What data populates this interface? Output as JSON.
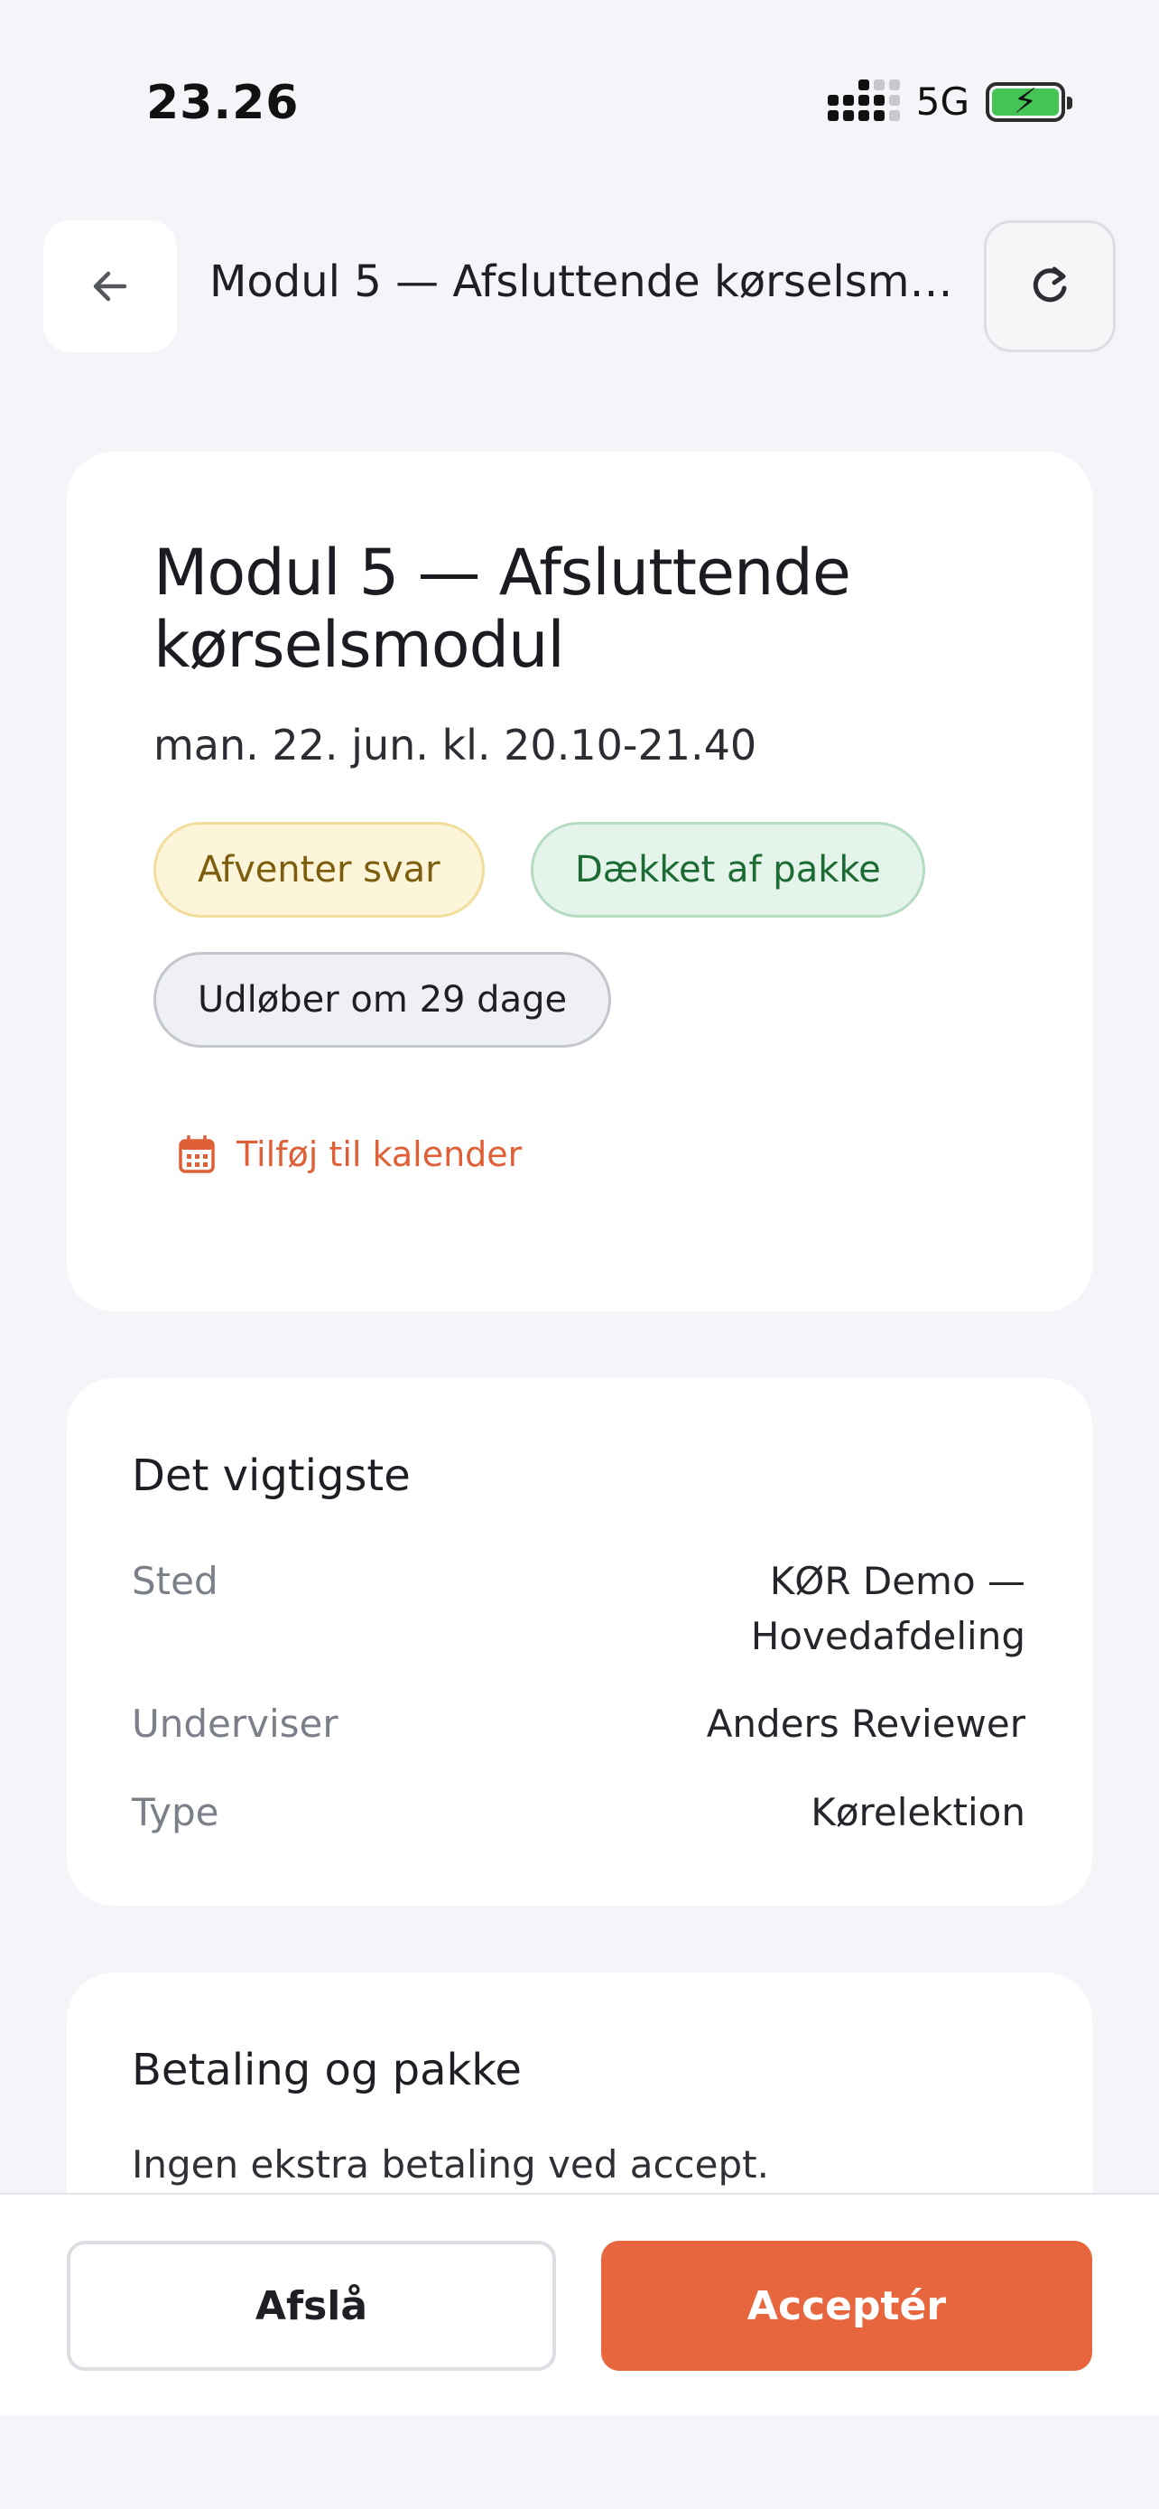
{
  "status_bar": {
    "time": "23.26",
    "network": "5G",
    "icons": {
      "signal": "signal-icon",
      "battery": "battery-charging-icon"
    }
  },
  "header": {
    "title": "Modul 5 — Afsluttende kørselsmo…",
    "back_icon": "arrow-left-icon",
    "refresh_icon": "refresh-icon"
  },
  "lesson": {
    "title": "Modul 5 — Afsluttende kørselsmodul",
    "date": "man. 22. jun. kl. 20.10-21.40",
    "badges": {
      "status": "Afventer svar",
      "coverage": "Dækket af pakke",
      "expiry": "Udløber om 29 dage"
    },
    "calendar_link": "Tilføj til kalender",
    "calendar_icon": "calendar-icon"
  },
  "info": {
    "title": "Det vigtigste",
    "rows": [
      {
        "label": "Sted",
        "value": "KØR Demo — Hovedafdeling"
      },
      {
        "label": "Underviser",
        "value": "Anders Reviewer"
      },
      {
        "label": "Type",
        "value": "Kørelektion"
      }
    ]
  },
  "payment": {
    "title": "Betaling og pakke",
    "text": "Ingen ekstra betaling ved accept."
  },
  "actions": {
    "decline": "Afslå",
    "accept": "Acceptér"
  },
  "colors": {
    "accent": "#e8663d",
    "pending_bg": "#fdf5da",
    "covered_bg": "#e5f4ea",
    "expiry_bg": "#eef0f4"
  }
}
